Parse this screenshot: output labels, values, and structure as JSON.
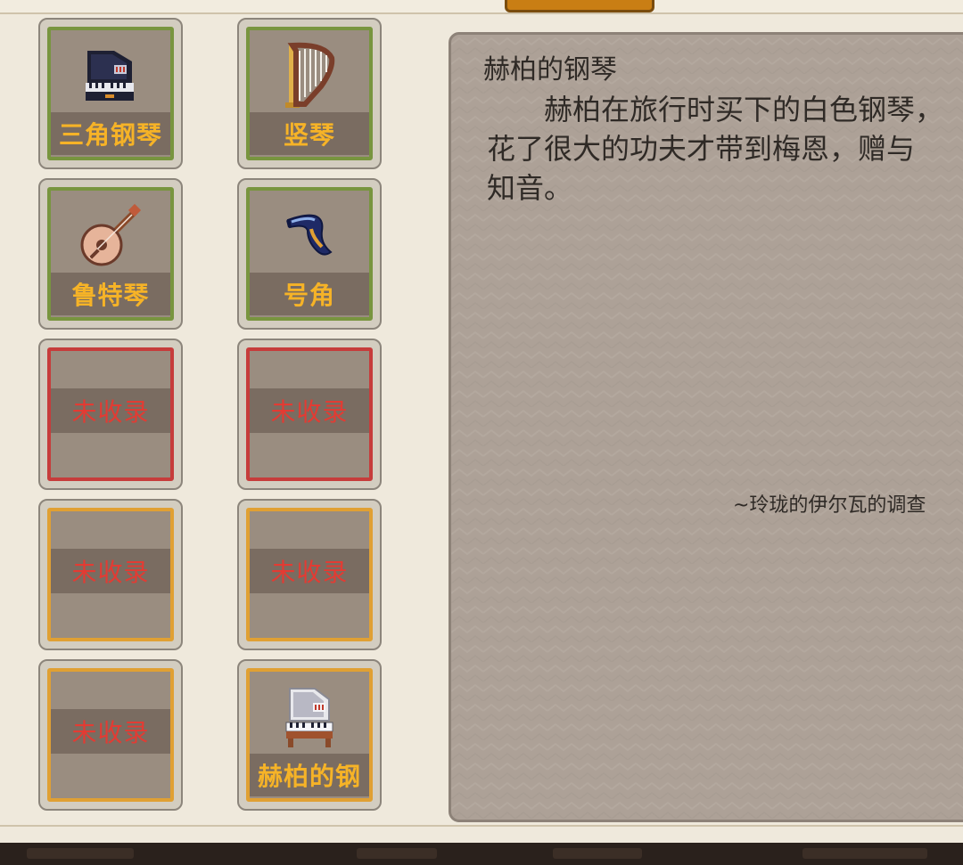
{
  "detail": {
    "title": "赫柏的钢琴",
    "body": "赫柏在旅行时买下的白色钢琴，\n花了很大的功夫才带到梅恩，赠与\n知音。",
    "source": "~玲珑的伊尔瓦的调查"
  },
  "slots": [
    {
      "label": "三角钢琴",
      "icon": "grand-piano-icon",
      "state": "collected"
    },
    {
      "label": "竖琴",
      "icon": "harp-icon",
      "state": "collected"
    },
    {
      "label": "鲁特琴",
      "icon": "lute-icon",
      "state": "collected"
    },
    {
      "label": "号角",
      "icon": "horn-icon",
      "state": "collected"
    },
    {
      "label": "未收录",
      "icon": "",
      "state": "locked"
    },
    {
      "label": "未收录",
      "icon": "",
      "state": "locked"
    },
    {
      "label": "未收录",
      "icon": "",
      "state": "locked"
    },
    {
      "label": "未收录",
      "icon": "",
      "state": "locked"
    },
    {
      "label": "未收录",
      "icon": "",
      "state": "locked"
    },
    {
      "label": "赫柏的钢",
      "icon": "white-piano-icon",
      "state": "collected"
    }
  ],
  "colors": {
    "frame_green": "#78953f",
    "frame_red": "#c63c3b",
    "frame_gold": "#e0a033",
    "label_gold": "#f6b327",
    "label_red": "#e33b33"
  }
}
